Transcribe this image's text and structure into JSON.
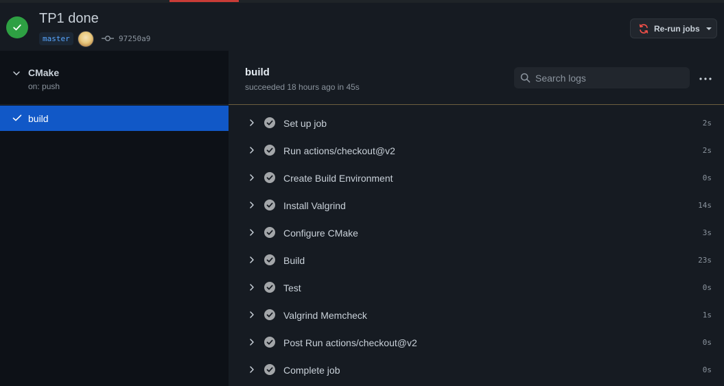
{
  "header": {
    "title": "TP1 done",
    "branch": "master",
    "commit_sha": "97250a9",
    "rerun_label": "Re-run jobs"
  },
  "sidebar": {
    "workflow_name": "CMake",
    "workflow_trigger": "on: push",
    "jobs": [
      {
        "label": "build"
      }
    ]
  },
  "job": {
    "title": "build",
    "subtitle": "succeeded 18 hours ago in 45s",
    "search_placeholder": "Search logs"
  },
  "steps": [
    {
      "label": "Set up job",
      "duration": "2s"
    },
    {
      "label": "Run actions/checkout@v2",
      "duration": "2s"
    },
    {
      "label": "Create Build Environment",
      "duration": "0s"
    },
    {
      "label": "Install Valgrind",
      "duration": "14s"
    },
    {
      "label": "Configure CMake",
      "duration": "3s"
    },
    {
      "label": "Build",
      "duration": "23s"
    },
    {
      "label": "Test",
      "duration": "0s"
    },
    {
      "label": "Valgrind Memcheck",
      "duration": "1s"
    },
    {
      "label": "Post Run actions/checkout@v2",
      "duration": "0s"
    },
    {
      "label": "Complete job",
      "duration": "0s"
    }
  ],
  "colors": {
    "success": "#2ea043",
    "selected": "#1158c7",
    "accent_link": "#58a6ff",
    "rerun_icon": "#f85149"
  }
}
